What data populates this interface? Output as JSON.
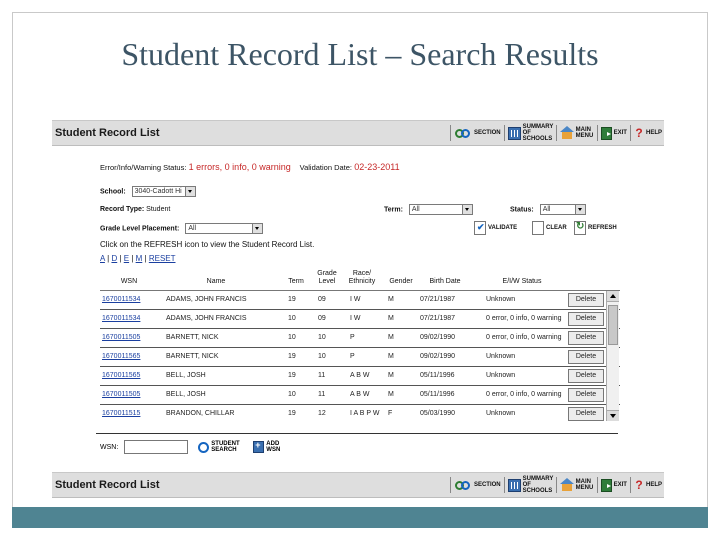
{
  "slide": {
    "title": "Student Record List – Search Results"
  },
  "toolbar": {
    "title": "Student Record List",
    "section_label": "SECTION",
    "summary_label": "SUMMARY OF SCHOOLS",
    "main_menu_label": "MAIN MENU",
    "exit_label": "EXIT",
    "help_label": "HELP"
  },
  "status": {
    "label": "Error/Info/Warning Status:",
    "value": "1 errors, 0 info, 0 warning",
    "validation_label": "Validation Date:",
    "validation_date": "02-23-2011"
  },
  "form": {
    "school_label": "School:",
    "school_value": "3040-Cadott Hi",
    "record_type_label": "Record Type:",
    "record_type_value": "Student",
    "term_label": "Term:",
    "term_value": "All",
    "status_label": "Status:",
    "status_value": "All",
    "grade_label": "Grade Level Placement:",
    "grade_value": "All"
  },
  "actions": {
    "validate": "VALIDATE",
    "clear": "CLEAR",
    "refresh": "REFRESH"
  },
  "instruction": "Click on the REFRESH icon to view the Student Record List.",
  "letters": [
    "A",
    "D",
    "E",
    "M",
    "RESET"
  ],
  "columns": {
    "wsn": "WSN",
    "name": "Name",
    "term": "Term",
    "grade_level": "Grade Level",
    "race_ethnicity": "Race/ Ethnicity",
    "gender": "Gender",
    "birth_date": "Birth Date",
    "eiw_status": "E/I/W Status"
  },
  "rows": [
    {
      "wsn": "1670011534",
      "name": "ADAMS, JOHN FRANCIS",
      "term": "19",
      "grade": "09",
      "race": "I W",
      "gender": "M",
      "birth": "07/21/1987",
      "status": "Unknown",
      "delete": "Delete"
    },
    {
      "wsn": "1670011534",
      "name": "ADAMS, JOHN FRANCIS",
      "term": "10",
      "grade": "09",
      "race": "I W",
      "gender": "M",
      "birth": "07/21/1987",
      "status": "0 error, 0 info, 0 warning",
      "delete": "Delete"
    },
    {
      "wsn": "1670011505",
      "name": "BARNETT, NICK",
      "term": "10",
      "grade": "10",
      "race": "P",
      "gender": "M",
      "birth": "09/02/1990",
      "status": "0 error, 0 info, 0 warning",
      "delete": "Delete"
    },
    {
      "wsn": "1670011565",
      "name": "BARNETT, NICK",
      "term": "19",
      "grade": "10",
      "race": "P",
      "gender": "M",
      "birth": "09/02/1990",
      "status": "Unknown",
      "delete": "Delete"
    },
    {
      "wsn": "1670011565",
      "name": "BELL, JOSH",
      "term": "19",
      "grade": "11",
      "race": "A B W",
      "gender": "M",
      "birth": "05/11/1996",
      "status": "Unknown",
      "delete": "Delete"
    },
    {
      "wsn": "1670011505",
      "name": "BELL, JOSH",
      "term": "10",
      "grade": "11",
      "race": "A B W",
      "gender": "M",
      "birth": "05/11/1996",
      "status": "0 error, 0 info, 0 warning",
      "delete": "Delete"
    },
    {
      "wsn": "1670011515",
      "name": "BRANDON, CHILLAR",
      "term": "19",
      "grade": "12",
      "race": "I A B P W",
      "gender": "F",
      "birth": "05/03/1990",
      "status": "Unknown",
      "delete": "Delete"
    }
  ],
  "search": {
    "wsn_label": "WSN:",
    "student_search_label": "STUDENT SEARCH",
    "add_wsn_label": "ADD WSN"
  },
  "colors": {
    "title": "#3d5566",
    "footer_band": "#4f8492",
    "toolbar_bg": "#dedede",
    "status_red": "#c62828",
    "link_blue": "#1a3fa0"
  }
}
